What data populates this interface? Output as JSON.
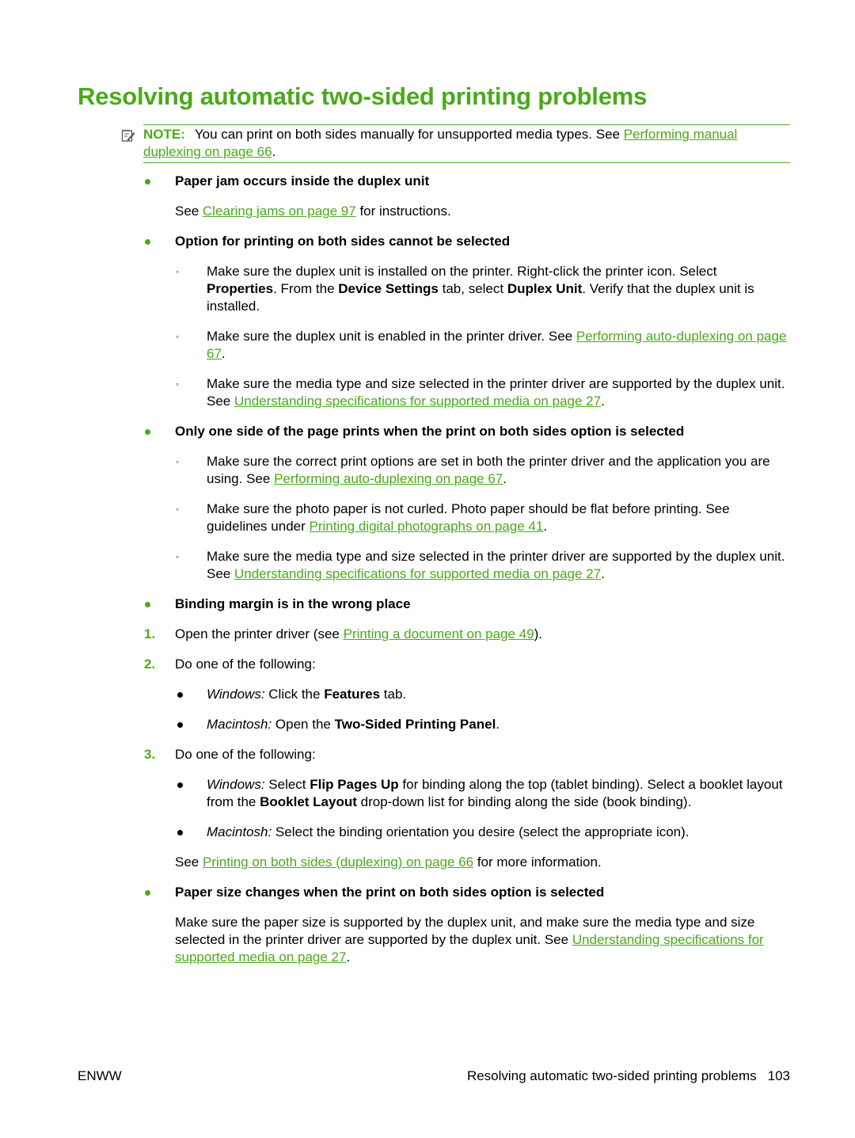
{
  "page": {
    "title": "Resolving automatic two-sided printing problems",
    "note": {
      "label": "NOTE:",
      "text": "You can print on both sides manually for unsupported media types. See ",
      "link": "Performing manual duplexing on page 66",
      "end": ".",
      "icon": "note-pad-icon"
    },
    "sections": [
      {
        "heading": "Paper jam occurs inside the duplex unit",
        "body_pre": "See ",
        "body_link": "Clearing jams on page 97",
        "body_post": " for instructions."
      },
      {
        "heading": "Option for printing on both sides cannot be selected",
        "items": [
          {
            "t1": "Make sure the duplex unit is installed on the printer. Right-click the printer icon. Select ",
            "b1": "Properties",
            "t2": ". From the ",
            "b2": "Device Settings",
            "t3": " tab, select ",
            "b3": "Duplex Unit",
            "t4": ". Verify that the duplex unit is installed."
          },
          {
            "pre": "Make sure the duplex unit is enabled in the printer driver. See ",
            "link": "Performing auto-duplexing on page 67",
            "post": "."
          },
          {
            "pre": "Make sure the media type and size selected in the printer driver are supported by the duplex unit. See ",
            "link": "Understanding specifications for supported media on page 27",
            "post": "."
          }
        ]
      },
      {
        "heading": "Only one side of the page prints when the print on both sides option is selected",
        "items": [
          {
            "pre": "Make sure the correct print options are set in both the printer driver and the application you are using. See ",
            "link": "Performing auto-duplexing on page 67",
            "post": "."
          },
          {
            "pre": "Make sure the photo paper is not curled. Photo paper should be flat before printing. See guidelines under ",
            "link": "Printing digital photographs on page 41",
            "post": "."
          },
          {
            "pre": "Make sure the media type and size selected in the printer driver are supported by the duplex unit. See ",
            "link": "Understanding specifications for supported media on page 27",
            "post": "."
          }
        ]
      },
      {
        "heading": "Binding margin is in the wrong place",
        "steps": [
          {
            "num": "1.",
            "pre": "Open the printer driver (see ",
            "link": "Printing a document on page 49",
            "post": ")."
          },
          {
            "num": "2.",
            "text": "Do one of the following:",
            "sub": [
              {
                "italic": "Windows:",
                "t1": " Click the ",
                "bold": "Features",
                "t2": " tab."
              },
              {
                "italic": "Macintosh:",
                "t1": " Open the ",
                "bold": "Two-Sided Printing Panel",
                "t2": "."
              }
            ]
          },
          {
            "num": "3.",
            "text": "Do one of the following:",
            "sub": [
              {
                "italic": "Windows:",
                "t1": " Select ",
                "bold": "Flip Pages Up",
                "t2": " for binding along the top (tablet binding). Select a booklet layout from the ",
                "bold2": "Booklet Layout",
                "t3": " drop-down list for binding along the side (book binding)."
              },
              {
                "italic": "Macintosh:",
                "t1": " Select the binding orientation you desire (select the appropriate icon)."
              }
            ]
          }
        ],
        "after_pre": "See ",
        "after_link": "Printing on both sides (duplexing) on page 66",
        "after_post": " for more information."
      },
      {
        "heading": "Paper size changes when the print on both sides option is selected",
        "body_pre": "Make sure the paper size is supported by the duplex unit, and make sure the media type and size selected in the printer driver are supported by the duplex unit. See ",
        "body_link": "Understanding specifications for supported media on page 27",
        "body_post": "."
      }
    ]
  },
  "footer": {
    "left": "ENWW",
    "right_title": "Resolving automatic two-sided printing problems",
    "page_number": "103"
  },
  "colors": {
    "accent": "#4aaa1a",
    "text": "#000000"
  }
}
